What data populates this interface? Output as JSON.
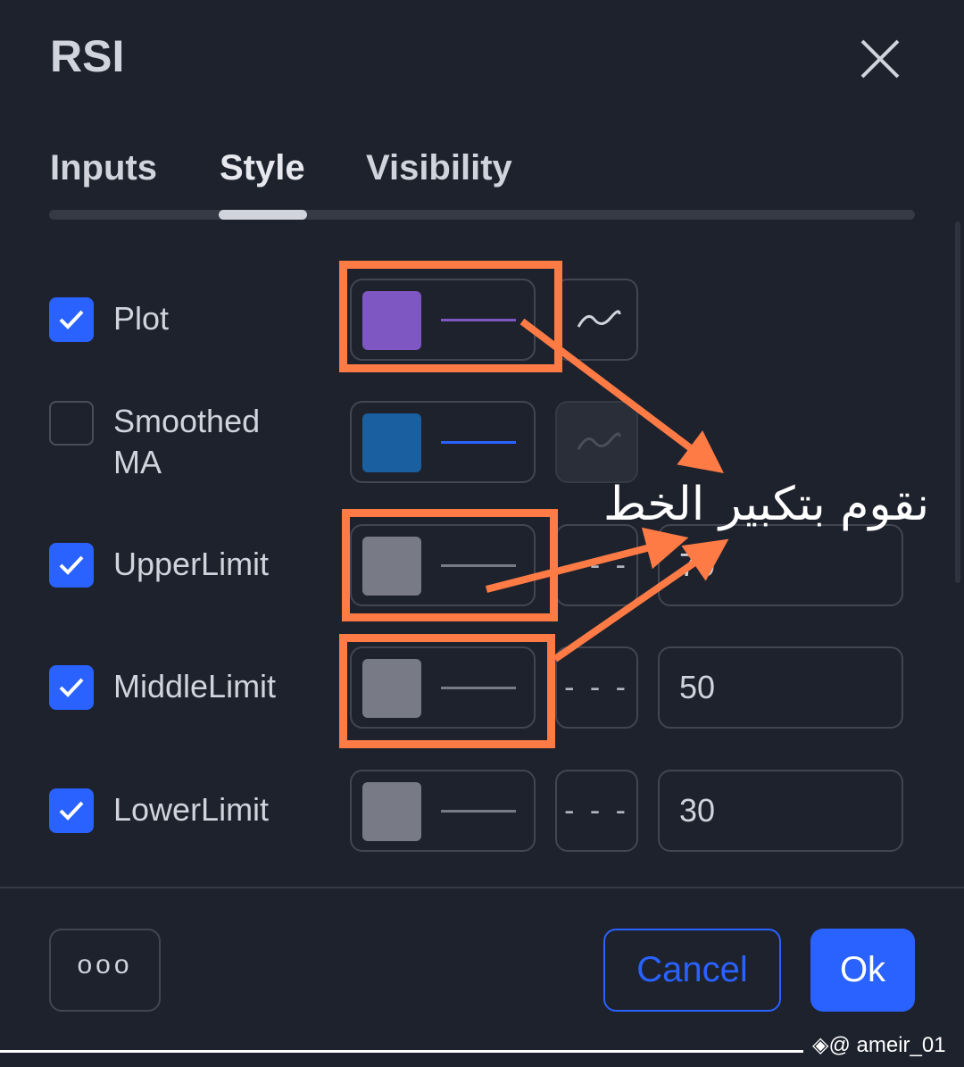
{
  "dialog": {
    "title": "RSI"
  },
  "tabs": [
    {
      "label": "Inputs"
    },
    {
      "label": "Style",
      "active": true
    },
    {
      "label": "Visibility"
    }
  ],
  "rows": [
    {
      "label": "Plot",
      "checked": true,
      "color": "#7e57c2",
      "line_color": "#7e57c2",
      "plot_style_icon": "wave-icon"
    },
    {
      "label_line1": "Smoothed",
      "label_line2": "MA",
      "checked": false,
      "color": "#1a5f9f",
      "line_color": "#2962ff",
      "plot_style_icon": "wave-icon",
      "disabled": true
    },
    {
      "label": "UpperLimit",
      "checked": true,
      "color": "#787b86",
      "line_color": "#787b86",
      "line_style": "- - -",
      "value": "70"
    },
    {
      "label": "MiddleLimit",
      "checked": true,
      "color": "#787b86",
      "line_color": "#787b86",
      "line_style": "- - -",
      "value": "50"
    },
    {
      "label": "LowerLimit",
      "checked": true,
      "color": "#787b86",
      "line_color": "#787b86",
      "line_style": "- - -",
      "value": "30"
    }
  ],
  "footer": {
    "more_label": "ooo",
    "cancel_label": "Cancel",
    "ok_label": "Ok"
  },
  "annotation": {
    "text": "نقوم بتكبير الخط",
    "color": "#ff7b45"
  },
  "watermark": {
    "text": "@ ameir_01"
  },
  "colors": {
    "background": "#1e222d",
    "accent": "#2962ff",
    "text": "#d1d4dc"
  }
}
